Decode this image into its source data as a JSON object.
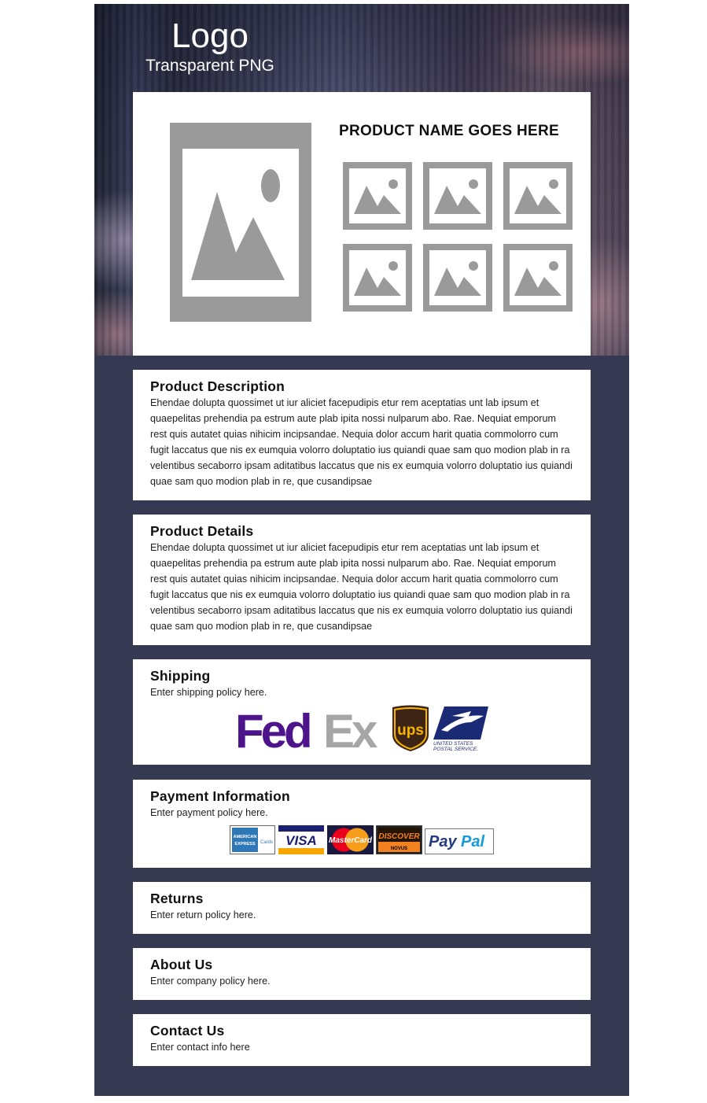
{
  "header": {
    "logo_title": "Logo",
    "logo_subtitle": "Transparent PNG"
  },
  "product": {
    "name": "PRODUCT NAME GOES HERE",
    "main_image_icon": "image-placeholder-icon",
    "thumbnail_icon": "image-placeholder-icon",
    "thumbnail_count": 6
  },
  "sections": {
    "description": {
      "title": "Product Description",
      "body": "Ehendae dolupta quossimet ut iur aliciet facepudipis etur rem aceptatias unt lab ipsum et quaepelitas prehendia pa estrum aute plab ipita nossi nulparum abo. Rae. Nequiat emporum rest quis autatet quias nihicim incipsandae. Nequia dolor accum harit quatia commolorro cum fugit laccatus que nis ex eumquia volorro doluptatio ius quiandi quae sam quo modion plab in ra velentibus secaborro ipsam aditatibus laccatus que nis ex eumquia volorro doluptatio ius quiandi quae sam quo modion plab in re, que cusandipsae"
    },
    "details": {
      "title": "Product Details",
      "body": "Ehendae dolupta quossimet ut iur aliciet facepudipis etur rem aceptatias unt lab ipsum et quaepelitas prehendia pa estrum aute plab ipita nossi nulparum abo. Rae. Nequiat emporum rest quis autatet quias nihicim incipsandae. Nequia dolor accum harit quatia commolorro cum fugit laccatus que nis ex eumquia volorro doluptatio ius quiandi quae sam quo modion plab in ra velentibus secaborro ipsam aditatibus laccatus que nis ex eumquia volorro doluptatio ius quiandi quae sam quo modion plab in re, que cusandipsae"
    },
    "shipping": {
      "title": "Shipping",
      "body": "Enter shipping policy here.",
      "carriers": {
        "fedex_fed": "Fed",
        "fedex_ex": "Ex",
        "ups": "ups",
        "usps_line1": "UNITED STATES",
        "usps_line2": "POSTAL SERVICE."
      }
    },
    "payment": {
      "title": "Payment Information",
      "body": "Enter payment policy here.",
      "cards": {
        "amex_line1": "AMERICAN",
        "amex_line2": "EXPRESS",
        "amex_word": "Cards",
        "visa": "VISA",
        "mastercard": "MasterCard",
        "discover": "DISCOVER",
        "novus": "NOVUS",
        "paypal_pay": "Pay",
        "paypal_pal": "Pal"
      }
    },
    "returns": {
      "title": "Returns",
      "body": "Enter return policy here."
    },
    "about": {
      "title": "About Us",
      "body": "Enter company policy here."
    },
    "contact": {
      "title": "Contact Us",
      "body": "Enter contact info here"
    }
  },
  "colors": {
    "page_background": "#353a52",
    "placeholder_gray": "#9a9a9a",
    "fedex_purple": "#4d148c",
    "fedex_gray": "#a6a6a6",
    "ups_brown": "#3d2414",
    "ups_gold": "#f7b500",
    "usps_blue": "#1b2a74",
    "visa_blue": "#1a1f71",
    "visa_gold": "#f7a600",
    "mastercard_red": "#eb001b",
    "mastercard_orange": "#f79e1b",
    "discover_orange": "#f58220",
    "paypal_dark": "#253b80",
    "paypal_light": "#179bd7"
  }
}
